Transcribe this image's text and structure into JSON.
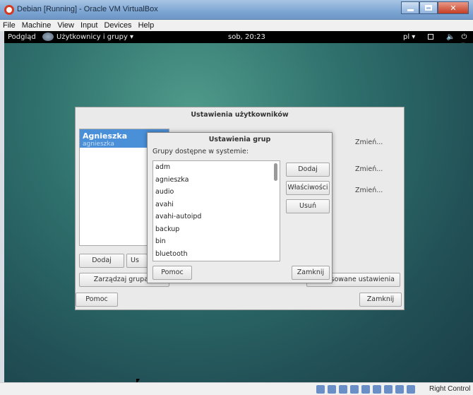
{
  "host": {
    "title": "Debian [Running] - Oracle VM VirtualBox",
    "menu": [
      "File",
      "Machine",
      "View",
      "Input",
      "Devices",
      "Help"
    ],
    "status_right": "Right Control"
  },
  "panel": {
    "activities": "Podgląd",
    "app_menu": "Użytkownicy i grupy ▾",
    "clock": "sob, 20:23",
    "lang": "pl ▾"
  },
  "user_dialog": {
    "title": "Ustawienia użytkowników",
    "selected_user_name": "Agnieszka",
    "selected_user_login": "agnieszka",
    "add_label": "Dodaj",
    "remove_label": "Us",
    "manage_groups_label": "Zarządzaj grupam",
    "advanced_label": "ansowane ustawienia",
    "help_label": "Pomoc",
    "close_label": "Zamknij",
    "change_labels": [
      "Zmień...",
      "Zmień...",
      "Zmień..."
    ]
  },
  "group_dialog": {
    "title": "Ustawienia grup",
    "subtitle": "Grupy dostępne w systemie:",
    "groups": [
      "adm",
      "agnieszka",
      "audio",
      "avahi",
      "avahi-autoipd",
      "backup",
      "bin",
      "bluetooth"
    ],
    "add_label": "Dodaj",
    "properties_label": "Właściwości",
    "remove_label": "Usuń",
    "help_label": "Pomoc",
    "close_label": "Zamknij"
  }
}
